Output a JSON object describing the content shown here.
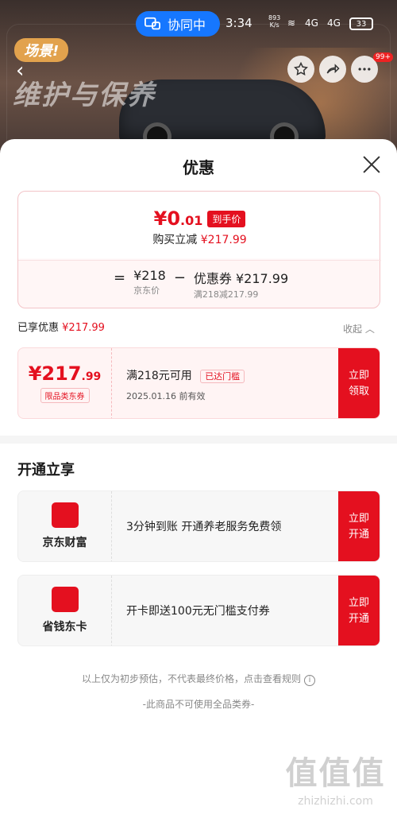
{
  "status_bar": {
    "collab_label": "协同中",
    "time": "3:34",
    "net_speed_value": "893",
    "net_speed_unit": "K/s",
    "signal_1": "4G",
    "signal_2": "4G",
    "battery": "33"
  },
  "banner": {
    "tag": "场景!",
    "title": "维护与保养",
    "cart_badge": "99+"
  },
  "sheet": {
    "title": "优惠",
    "price_card": {
      "final_currency": "¥",
      "final_int": "0",
      "final_dec": ".01",
      "deal_tag": "到手价",
      "reduce_label": "购买立减",
      "reduce_value": "¥217.99",
      "equals": "=",
      "jd_price": "¥218",
      "jd_price_label": "京东价",
      "minus": "−",
      "coupon_label": "优惠券 ¥217.99",
      "coupon_rule": "满218减217.99"
    },
    "enjoyed": {
      "label": "已享优惠",
      "value": "¥217.99",
      "collapse_label": "收起"
    },
    "coupon": {
      "currency": "¥",
      "amount_int": "217",
      "amount_dec": ".99",
      "scope": "限品类东券",
      "condition": "满218元可用",
      "status_tag": "已达门槛",
      "valid": "2025.01.16 前有效",
      "claim_line1": "立即",
      "claim_line2": "领取"
    },
    "open_section": {
      "title": "开通立享",
      "cards": [
        {
          "name": "京东财富",
          "desc": "3分钟到账 开通养老服务免费领",
          "btn_line1": "立即",
          "btn_line2": "开通"
        },
        {
          "name": "省钱东卡",
          "desc": "开卡即送100元无门槛支付券",
          "btn_line1": "立即",
          "btn_line2": "开通"
        }
      ]
    },
    "footnote": "以上仅为初步预估，不代表最终价格，点击查看规则",
    "footnote2": "-此商品不可使用全品类券-"
  },
  "watermark": {
    "glyphs": "值值值",
    "site": "zhizhizhi.com"
  },
  "colors": {
    "brand_red": "#e4101f",
    "collab_blue": "#1677ff"
  }
}
